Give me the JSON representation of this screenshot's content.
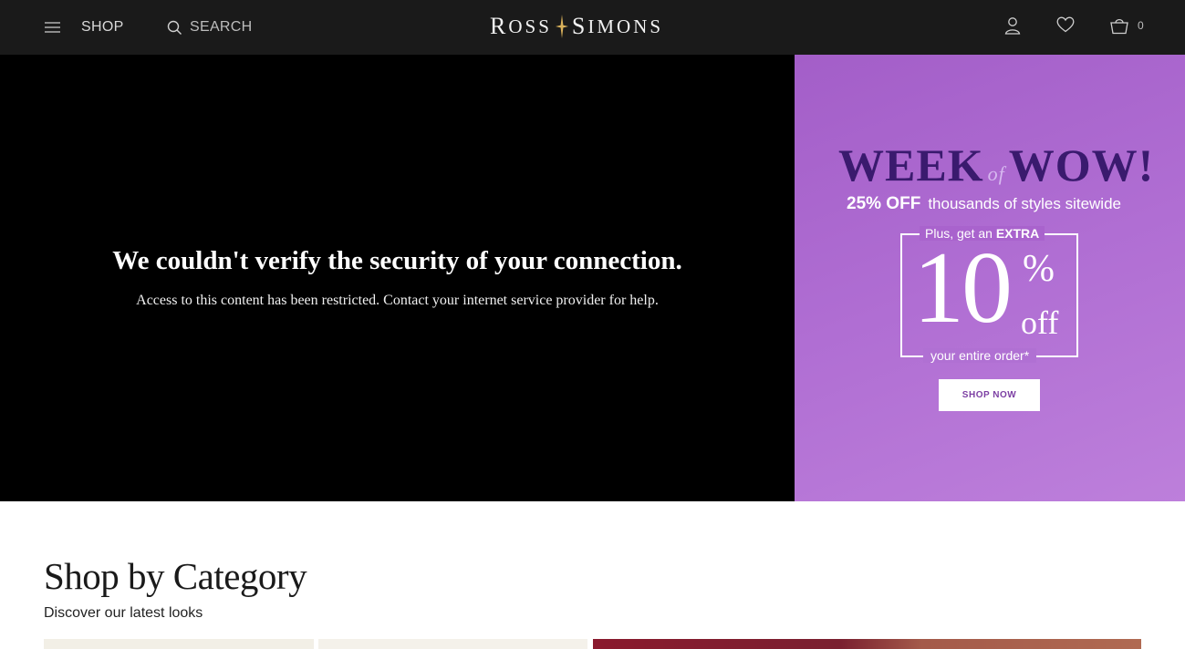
{
  "header": {
    "shop_label": "SHOP",
    "search_label": "SEARCH",
    "logo_first": "R",
    "logo_first_rest": "OSS",
    "logo_second": "S",
    "logo_second_rest": "IMONS",
    "bag_count": "0"
  },
  "blocked": {
    "title": "We couldn't verify the security of your connection.",
    "message": "Access to this content has been restricted. Contact your internet service provider for help."
  },
  "promo": {
    "title_left": "WEEK",
    "title_of": "of",
    "title_right": "WOW!",
    "discount": "25% OFF",
    "discount_text": "thousands of styles sitewide",
    "extra_prefix": "Plus, get an",
    "extra_bold": "EXTRA",
    "big_number": "10",
    "percent": "%",
    "off": "off",
    "entire_order": "your entire order*",
    "cta": "SHOP NOW"
  },
  "category": {
    "title": "Shop by Category",
    "subtitle": "Discover our latest looks"
  },
  "colors": {
    "header_bg": "#1a1a1a",
    "promo_purple": "#b06ed3",
    "wow_text": "#3a1a6e"
  }
}
